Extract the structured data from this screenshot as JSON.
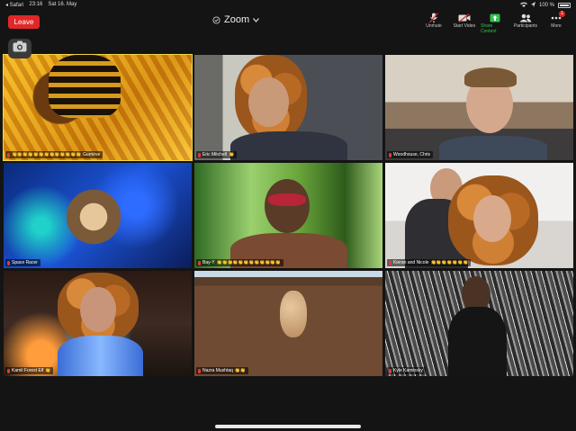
{
  "status_bar": {
    "back_app": "◂ Safari",
    "time": "23:16",
    "date": "Sat 16. May",
    "battery": "100 %"
  },
  "header": {
    "leave_label": "Leave",
    "title": "Zoom"
  },
  "toolbar": {
    "items": [
      {
        "label": "Unmute",
        "icon": "mic-off-icon"
      },
      {
        "label": "Start Video",
        "icon": "video-off-icon"
      },
      {
        "label": "Share Content",
        "icon": "share-screen-icon"
      },
      {
        "label": "Participants",
        "icon": "participants-icon"
      },
      {
        "label": "More",
        "icon": "more-icon",
        "badge": "1"
      }
    ]
  },
  "participants": [
    {
      "name": "Gurriève",
      "reactions": "👏👏👏👏👏👏👏👏👏👏👏👏👏"
    },
    {
      "name": "Eric Mitchell",
      "reactions": "👏"
    },
    {
      "name": "Woodhouse, Chris",
      "reactions": ""
    },
    {
      "name": "Space Racer",
      "reactions": ""
    },
    {
      "name": "Bay-Y",
      "reactions": "👏👏👏👏👏👏👏👏👏👏👏👏"
    },
    {
      "name": "Kieran and Nicole",
      "reactions": "👏👏👏👏👏👏👏"
    },
    {
      "name": "Kamil Forest Elf",
      "reactions": "👏"
    },
    {
      "name": "Nazra Mushtaq",
      "reactions": "👏👏"
    },
    {
      "name": "Kyle Kaminsky",
      "reactions": ""
    }
  ],
  "colors": {
    "leave": "#e02828",
    "active_speaker": "#f2d64a",
    "share": "#33c24d"
  }
}
